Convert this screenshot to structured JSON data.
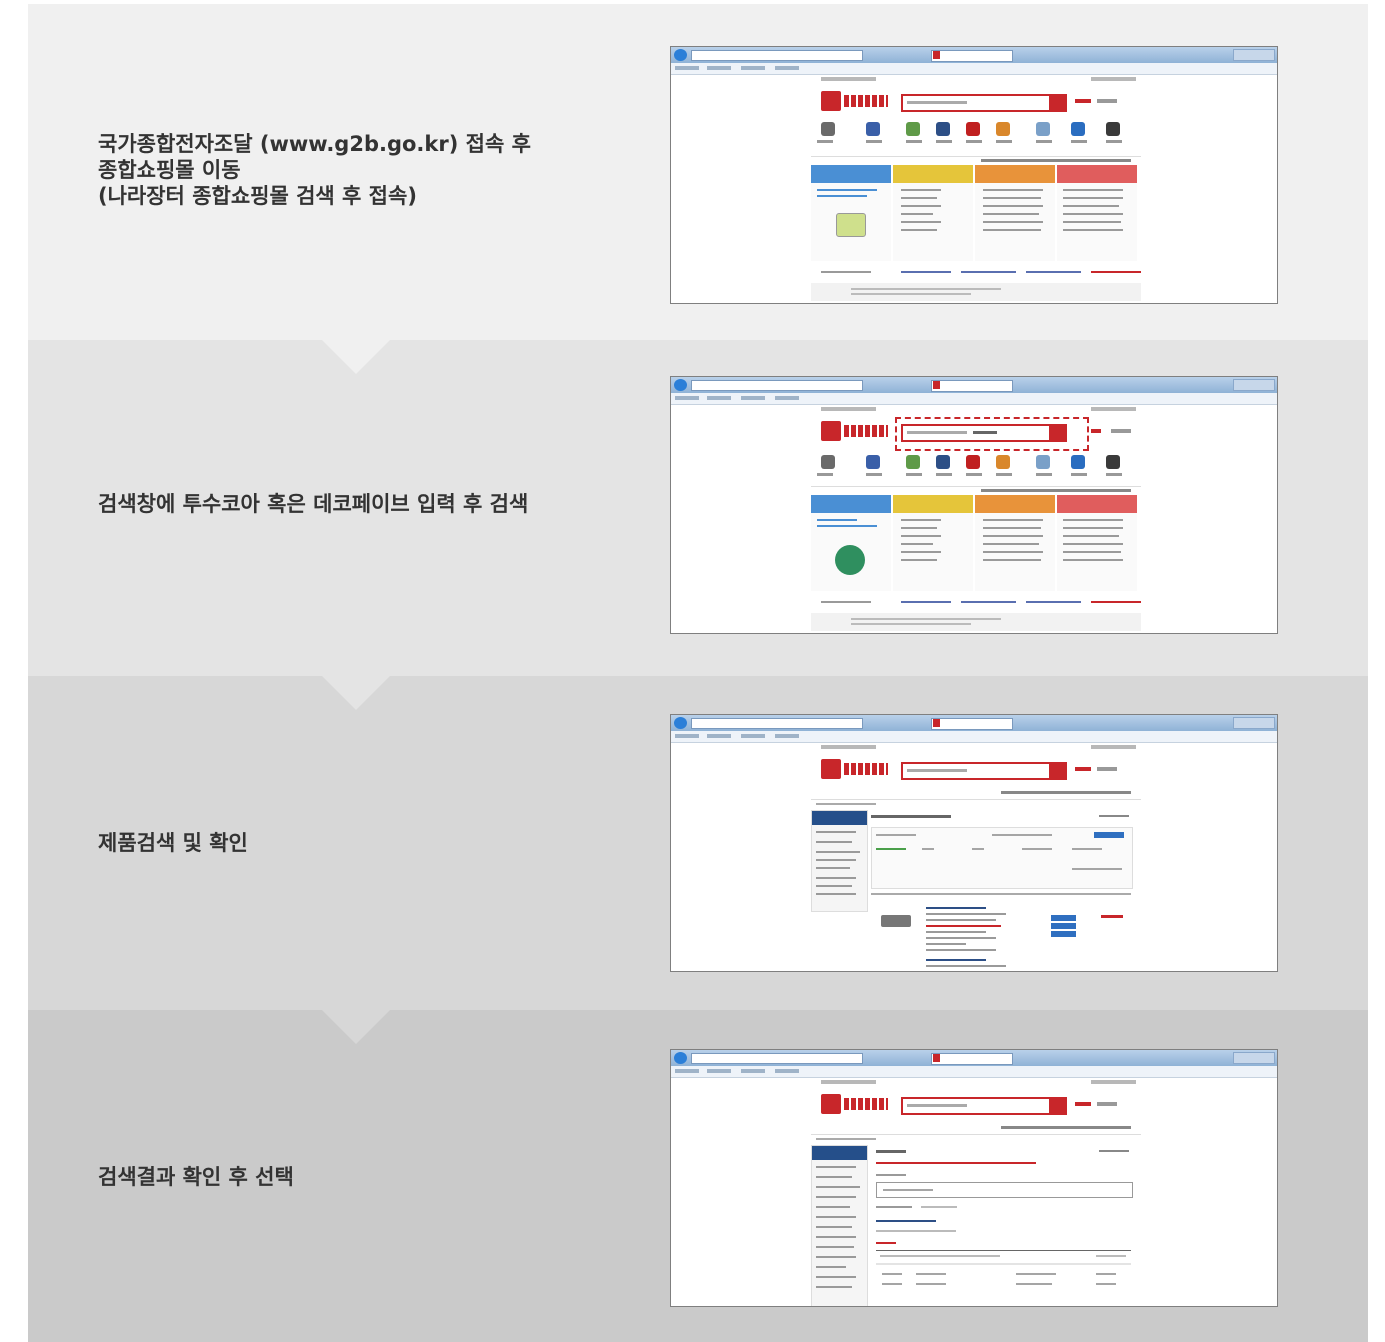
{
  "steps": [
    {
      "text": "국가종합전자조달 (www.g2b.go.kr) 접속 후\n종합쇼핑몰 이동\n(나라장터 종합쇼핑몰 검색 후 접속)",
      "bg": "#f0f0f0"
    },
    {
      "text": "검색창에 투수코아 혹은 데코페이브 입력 후 검색",
      "bg": "#e4e4e4"
    },
    {
      "text": "제품검색 및 확인",
      "bg": "#d7d7d7"
    },
    {
      "text": "검색결과 확인 후 선택",
      "bg": "#cacaca"
    }
  ],
  "colors": {
    "accent_red": "#c8262a",
    "nav_blue": "#254f8a",
    "panel_blue": "#4a8fd4",
    "panel_yellow": "#e5c53a",
    "panel_orange": "#e8933a",
    "panel_pink": "#e05d5d"
  },
  "icons": [
    "internet-explorer-icon",
    "shopping-mall-logo-icon",
    "category-icon",
    "search-button-icon"
  ]
}
